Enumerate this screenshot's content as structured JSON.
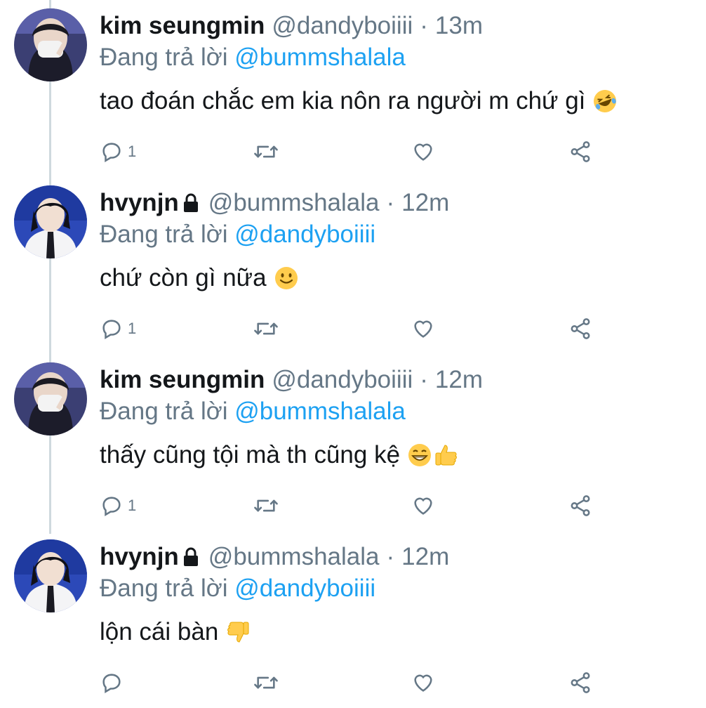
{
  "theme": {
    "text": "#14171a",
    "muted": "#657786",
    "accent": "#1da1f2",
    "thread_line": "#cfd9de"
  },
  "tweets": [
    {
      "display_name": "kim seungmin",
      "handle": "@dandyboiiii",
      "separator": "·",
      "time": "13m",
      "protected": false,
      "reply_label": "Đang trả lời",
      "reply_to": "@bummshalala",
      "text": "tao đoán chắc em kia nôn ra người m chứ gì",
      "emojis": [
        "rofl-emoji"
      ],
      "reply_count": "1"
    },
    {
      "display_name": "hvynjn",
      "handle": "@bummshalala",
      "separator": "·",
      "time": "12m",
      "protected": true,
      "reply_label": "Đang trả lời",
      "reply_to": "@dandyboiiii",
      "text": "chứ còn gì nữa",
      "emojis": [
        "slight-smile-emoji"
      ],
      "reply_count": "1"
    },
    {
      "display_name": "kim seungmin",
      "handle": "@dandyboiiii",
      "separator": "·",
      "time": "12m",
      "protected": false,
      "reply_label": "Đang trả lời",
      "reply_to": "@bummshalala",
      "text": "thấy cũng tội mà th cũng kệ",
      "emojis": [
        "grin-emoji",
        "thumbs-up-emoji"
      ],
      "reply_count": "1"
    },
    {
      "display_name": "hvynjn",
      "handle": "@bummshalala",
      "separator": "·",
      "time": "12m",
      "protected": true,
      "reply_label": "Đang trả lời",
      "reply_to": "@dandyboiiii",
      "text": "lộn cái bàn",
      "emojis": [
        "thumbs-down-emoji"
      ],
      "reply_count": ""
    }
  ]
}
